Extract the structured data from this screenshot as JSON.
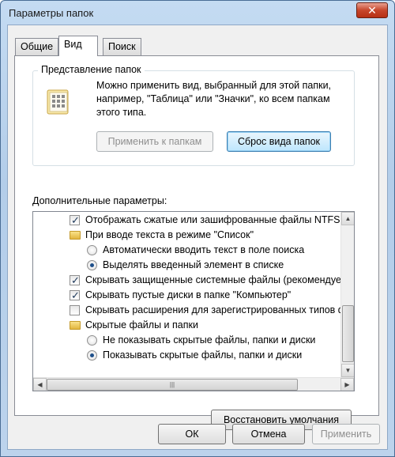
{
  "window": {
    "title": "Параметры папок",
    "close_glyph": "✕"
  },
  "tabs": [
    {
      "label": "Общие",
      "active": false
    },
    {
      "label": "Вид",
      "active": true
    },
    {
      "label": "Поиск",
      "active": false
    }
  ],
  "folder_views": {
    "group_label": "Представление папок",
    "description": "Можно применить вид, выбранный для этой папки, например, \"Таблица\" или \"Значки\", ко всем папкам этого типа.",
    "apply_button": "Применить к папкам",
    "reset_button": "Сброс вида папок"
  },
  "advanced": {
    "label": "Дополнительные параметры:",
    "items": [
      {
        "type": "checkbox",
        "checked": true,
        "indent": 1,
        "text": "Отображать сжатые или зашифрованные файлы NTFS другим цветом"
      },
      {
        "type": "folder",
        "indent": 1,
        "text": "При вводе текста в режиме \"Список\""
      },
      {
        "type": "radio",
        "checked": false,
        "indent": 2,
        "text": "Автоматически вводить текст в поле поиска"
      },
      {
        "type": "radio",
        "checked": true,
        "indent": 2,
        "text": "Выделять введенный элемент в списке"
      },
      {
        "type": "checkbox",
        "checked": true,
        "indent": 1,
        "text": "Скрывать защищенные системные файлы (рекомендуется)"
      },
      {
        "type": "checkbox",
        "checked": true,
        "indent": 1,
        "text": "Скрывать пустые диски в папке \"Компьютер\""
      },
      {
        "type": "checkbox",
        "checked": false,
        "indent": 1,
        "text": "Скрывать расширения для зарегистрированных типов файлов"
      },
      {
        "type": "folder",
        "indent": 1,
        "text": "Скрытые файлы и папки"
      },
      {
        "type": "radio",
        "checked": false,
        "indent": 2,
        "text": "Не показывать скрытые файлы, папки и диски"
      },
      {
        "type": "radio",
        "checked": true,
        "indent": 2,
        "text": "Показывать скрытые файлы, папки и диски"
      }
    ]
  },
  "restore_defaults_button": "Восстановить умолчания",
  "footer": {
    "ok": "ОК",
    "cancel": "Отмена",
    "apply": "Применить"
  },
  "scroll": {
    "up": "▲",
    "down": "▼",
    "left": "◀",
    "right": "▶",
    "grip": "|||"
  }
}
